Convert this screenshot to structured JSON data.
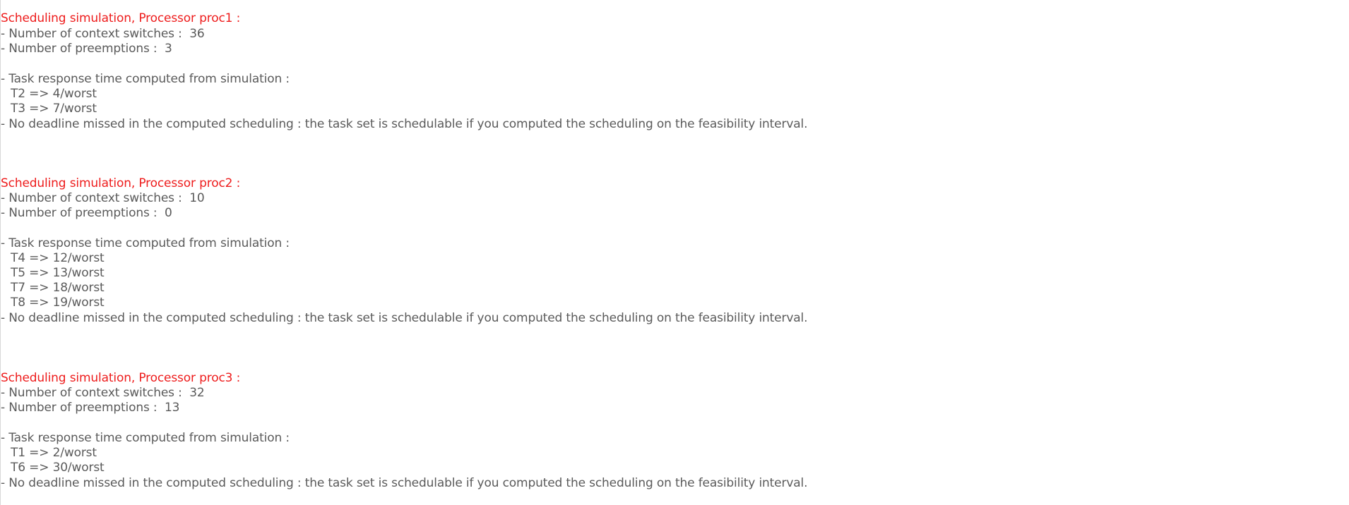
{
  "header_color": "#ee1c1c",
  "text_color": "#5a5a5a",
  "processors": [
    {
      "header": "Scheduling simulation, Processor proc1 :",
      "context_switches": "- Number of context switches :  36",
      "preemptions": "- Number of preemptions :  3",
      "response_title": "- Task response time computed from simulation :",
      "tasks": [
        "T2 => 4/worst",
        "T3 => 7/worst"
      ],
      "deadline": "- No deadline missed in the computed scheduling : the task set is schedulable if you computed the scheduling on the feasibility interval."
    },
    {
      "header": "Scheduling simulation, Processor proc2 :",
      "context_switches": "- Number of context switches :  10",
      "preemptions": "- Number of preemptions :  0",
      "response_title": "- Task response time computed from simulation :",
      "tasks": [
        "T4 => 12/worst",
        "T5 => 13/worst",
        "T7 => 18/worst",
        "T8 => 19/worst"
      ],
      "deadline": "- No deadline missed in the computed scheduling : the task set is schedulable if you computed the scheduling on the feasibility interval."
    },
    {
      "header": "Scheduling simulation, Processor proc3 :",
      "context_switches": "- Number of context switches :  32",
      "preemptions": "- Number of preemptions :  13",
      "response_title": "- Task response time computed from simulation :",
      "tasks": [
        "T1 => 2/worst",
        "T6 => 30/worst"
      ],
      "deadline": "- No deadline missed in the computed scheduling : the task set is schedulable if you computed the scheduling on the feasibility interval."
    }
  ]
}
